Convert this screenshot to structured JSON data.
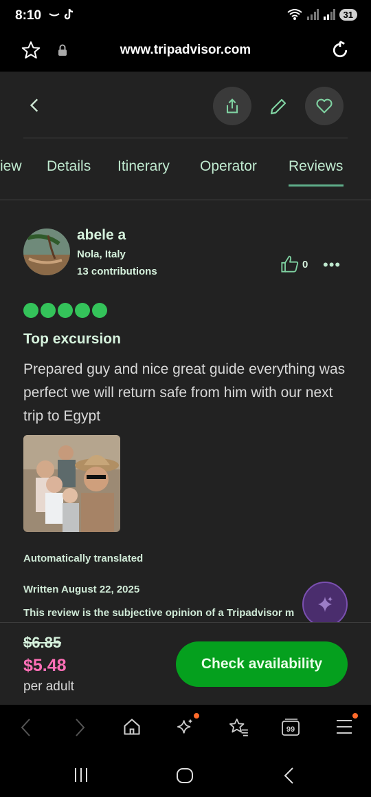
{
  "status_bar": {
    "time": "8:10",
    "battery": "31"
  },
  "browser": {
    "url": "www.tripadvisor.com"
  },
  "tabs": [
    {
      "label": "iew"
    },
    {
      "label": "Details"
    },
    {
      "label": "Itinerary"
    },
    {
      "label": "Operator"
    },
    {
      "label": "Reviews"
    }
  ],
  "review": {
    "reviewer_name": "abele a",
    "location": "Nola, Italy",
    "contributions": "13 contributions",
    "likes": "0",
    "rating": 5,
    "title": "Top excursion",
    "body": "Prepared guy and nice great guide everything was perfect we will return safe from him with our next trip to Egypt",
    "auto_translated": "Automatically translated",
    "written": "Written August 22, 2025",
    "disclaimer": "This review is the subjective opinion of a Tripadvisor m"
  },
  "booking": {
    "old_price": "$6.85",
    "new_price": "$5.48",
    "unit": "per adult",
    "cta_label": "Check availability"
  },
  "colors": {
    "rating_green": "#34c35a",
    "cta_green": "#05a01e",
    "sale_price_pink": "#ff6fb7",
    "ai_fab_purple": "#4a2d6d"
  }
}
